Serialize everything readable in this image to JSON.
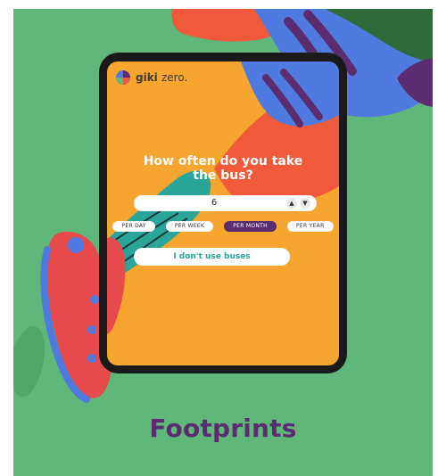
{
  "app": {
    "brand": "giki",
    "brand_suffix": "zero."
  },
  "screen": {
    "question_line1": "How often do you take",
    "question_line2": "the bus?",
    "stepper_value": "6",
    "frequency_options": [
      {
        "label": "PER DAY",
        "selected": false
      },
      {
        "label": "PER WEEK",
        "selected": false
      },
      {
        "label": "PER MONTH",
        "selected": true
      },
      {
        "label": "PER YEAR",
        "selected": false
      }
    ],
    "no_bus_label": "I don't use buses"
  },
  "page": {
    "title": "Footprints"
  },
  "colors": {
    "background_green": "#5fb77a",
    "screen_orange": "#f6a62f",
    "brand_purple": "#5b2c6f",
    "accent_coral": "#f05a3b",
    "accent_blue": "#4f7be0",
    "teal_text": "#2aa59a"
  },
  "icons": {
    "stepper_up": "chevron-up-icon",
    "stepper_down": "chevron-down-icon",
    "logo": "giki-logo-icon"
  }
}
